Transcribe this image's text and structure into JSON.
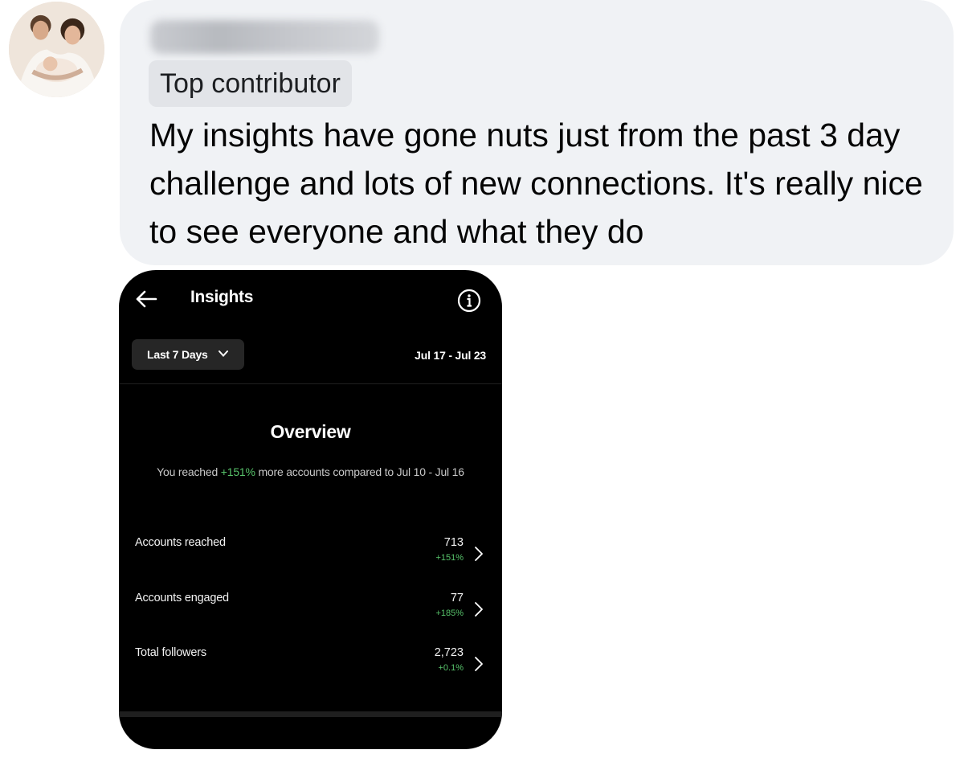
{
  "comment": {
    "badge": "Top contributor",
    "text": "My insights have gone nuts just from the past 3 day challenge and lots of new connections. It's really nice to see everyone and what they do"
  },
  "screenshot": {
    "header": {
      "title": "Insights",
      "back_icon": "arrow-left-icon",
      "info_icon": "info-icon"
    },
    "filter": {
      "label": "Last 7 Days",
      "date_range": "Jul 17 - Jul 23"
    },
    "overview": {
      "title": "Overview",
      "desc_prefix": "You reached ",
      "desc_highlight": "+151%",
      "desc_suffix": " more accounts compared to Jul 10 - Jul 16"
    },
    "metrics": [
      {
        "label": "Accounts reached",
        "value": "713",
        "change": "+151%"
      },
      {
        "label": "Accounts engaged",
        "value": "77",
        "change": "+185%"
      },
      {
        "label": "Total followers",
        "value": "2,723",
        "change": "+0.1%"
      }
    ],
    "colors": {
      "positive": "#57c26a",
      "bubble": "#f0f2f5",
      "screen": "#000000"
    }
  }
}
